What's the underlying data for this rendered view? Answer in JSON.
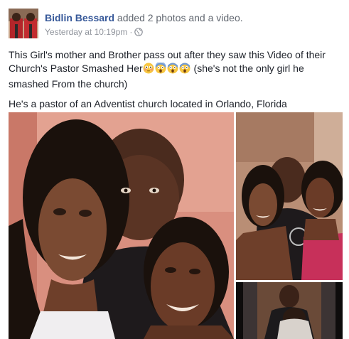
{
  "post": {
    "author_name": "Bidlin Bessard",
    "action": "added 2 photos and a video.",
    "timestamp": "Yesterday at 10:19pm",
    "separator": "·",
    "privacy_icon": "globe-icon",
    "text_para1_a": "This Girl's mother and Brother pass out after they saw this Video of their Church's Pastor Smashed Her",
    "text_para1_b": " (she's not the only girl he smashed From the church)",
    "text_para2": "He's a pastor of an Adventist church located in Orlando, Florida",
    "emojis": [
      "flushed-face-emoji",
      "screaming-face-emoji",
      "screaming-face-emoji",
      "screaming-face-emoji"
    ]
  },
  "colors": {
    "link": "#365899",
    "meta": "#90949c",
    "text": "#1d2129"
  }
}
